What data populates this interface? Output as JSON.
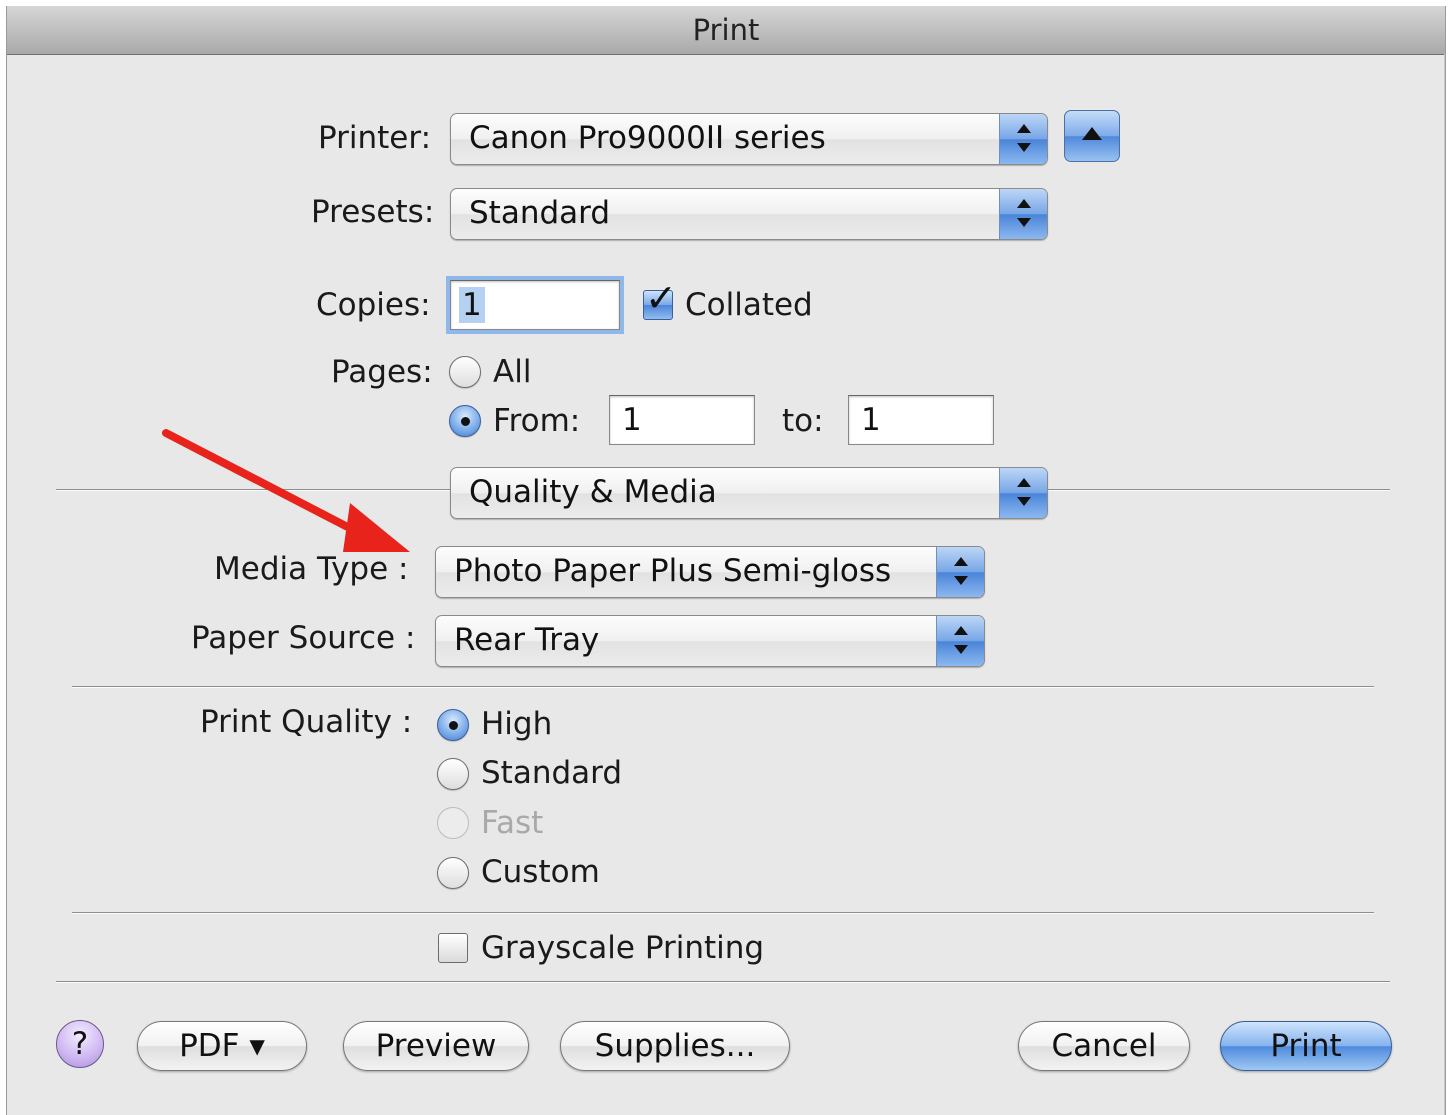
{
  "window": {
    "title": "Print"
  },
  "printer": {
    "label": "Printer:",
    "value": "Canon Pro9000II series"
  },
  "presets": {
    "label": "Presets:",
    "value": "Standard"
  },
  "copies": {
    "label": "Copies:",
    "value": "1",
    "collated_label": "Collated",
    "collated": true
  },
  "pages": {
    "label": "Pages:",
    "all_label": "All",
    "from_label": "From:",
    "from_value": "1",
    "to_label": "to:",
    "to_value": "1",
    "selected": "from"
  },
  "panel": {
    "value": "Quality & Media"
  },
  "media_type": {
    "label": "Media Type :",
    "value": "Photo Paper Plus Semi-gloss"
  },
  "paper_source": {
    "label": "Paper Source :",
    "value": "Rear Tray"
  },
  "print_quality": {
    "label": "Print Quality :",
    "options": [
      {
        "label": "High",
        "selected": true,
        "enabled": true
      },
      {
        "label": "Standard",
        "selected": false,
        "enabled": true
      },
      {
        "label": "Fast",
        "selected": false,
        "enabled": false
      },
      {
        "label": "Custom",
        "selected": false,
        "enabled": true
      }
    ]
  },
  "grayscale": {
    "label": "Grayscale Printing",
    "checked": false
  },
  "buttons": {
    "help": "?",
    "pdf": "PDF ▾",
    "preview": "Preview",
    "supplies": "Supplies...",
    "cancel": "Cancel",
    "print": "Print"
  },
  "colors": {
    "annotation_arrow": "#e8231b",
    "accent": "#4f88db"
  }
}
